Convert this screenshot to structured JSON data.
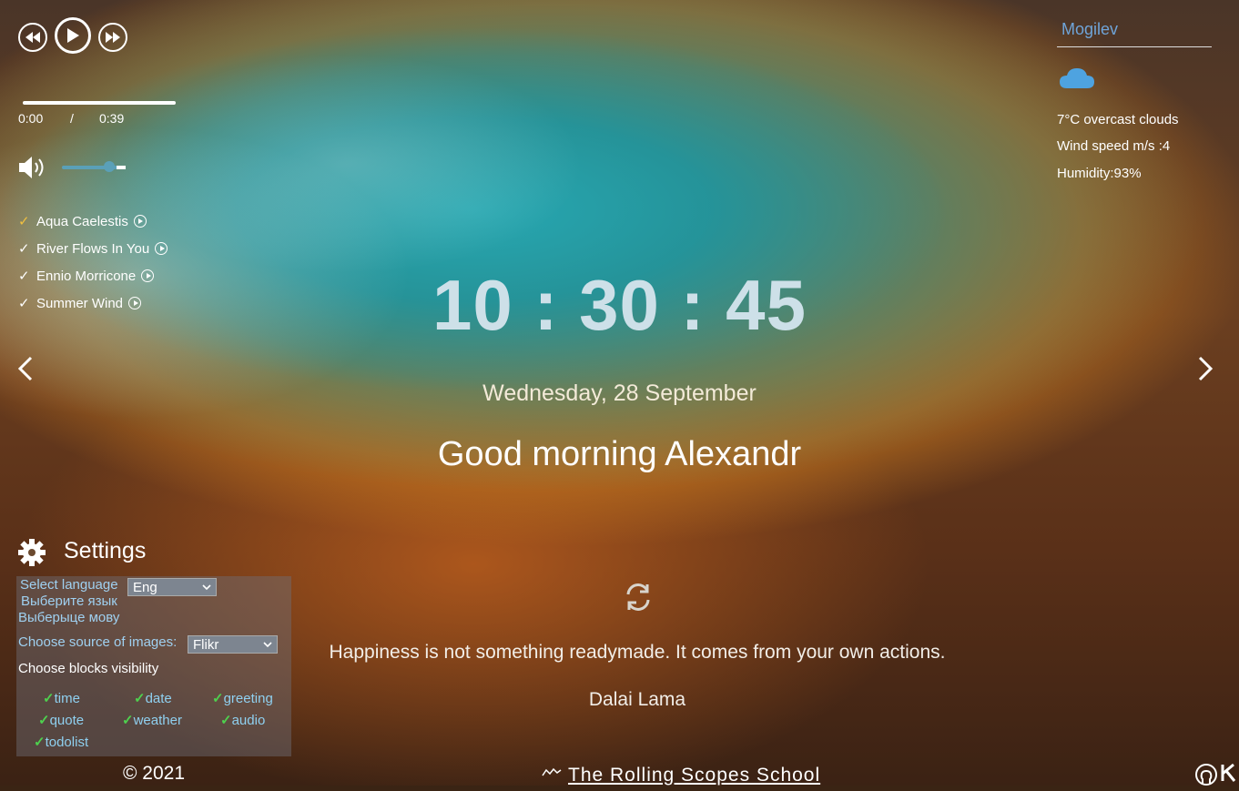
{
  "player": {
    "current_time": "0:00",
    "separator": "/",
    "duration": "0:39",
    "progress": 1.0,
    "volume": 0.7,
    "tracks": [
      {
        "check": "✓",
        "title": "Aqua Caelestis",
        "active": true
      },
      {
        "check": "✓",
        "title": "River Flows In You",
        "active": false
      },
      {
        "check": "✓",
        "title": "Ennio Morricone",
        "active": false
      },
      {
        "check": "✓",
        "title": "Summer Wind",
        "active": false
      }
    ]
  },
  "weather": {
    "city": "Mogilev",
    "icon": "cloud-icon",
    "temp_desc": "7°C   overcast clouds",
    "wind": "Wind speed m/s :4",
    "humidity": "Humidity:93%"
  },
  "clock": {
    "time": "10 : 30 : 45"
  },
  "date": "Wednesday, 28 September",
  "greeting": "Good morning  Alexandr",
  "quote": {
    "text": "Happiness is not something readymade. It comes from your own actions.",
    "author": "Dalai Lama"
  },
  "settings": {
    "title": "Settings",
    "lang_labels": [
      "Select language",
      "Выберите язык",
      "Выберыце мову"
    ],
    "lang_value": "Eng",
    "source_label": "Choose source of images:",
    "source_value": "Flikr",
    "visibility_label": "Choose blocks visibility",
    "blocks": [
      "time",
      "date",
      "greeting",
      "quote",
      "weather",
      "audio",
      "todolist"
    ]
  },
  "footer": {
    "copyright": "© 2021",
    "school": "The Rolling Scopes School"
  },
  "colors": {
    "accent_check": "#4ed04e",
    "label_blue": "#9fd0f0",
    "city": "#6fa4d8"
  }
}
